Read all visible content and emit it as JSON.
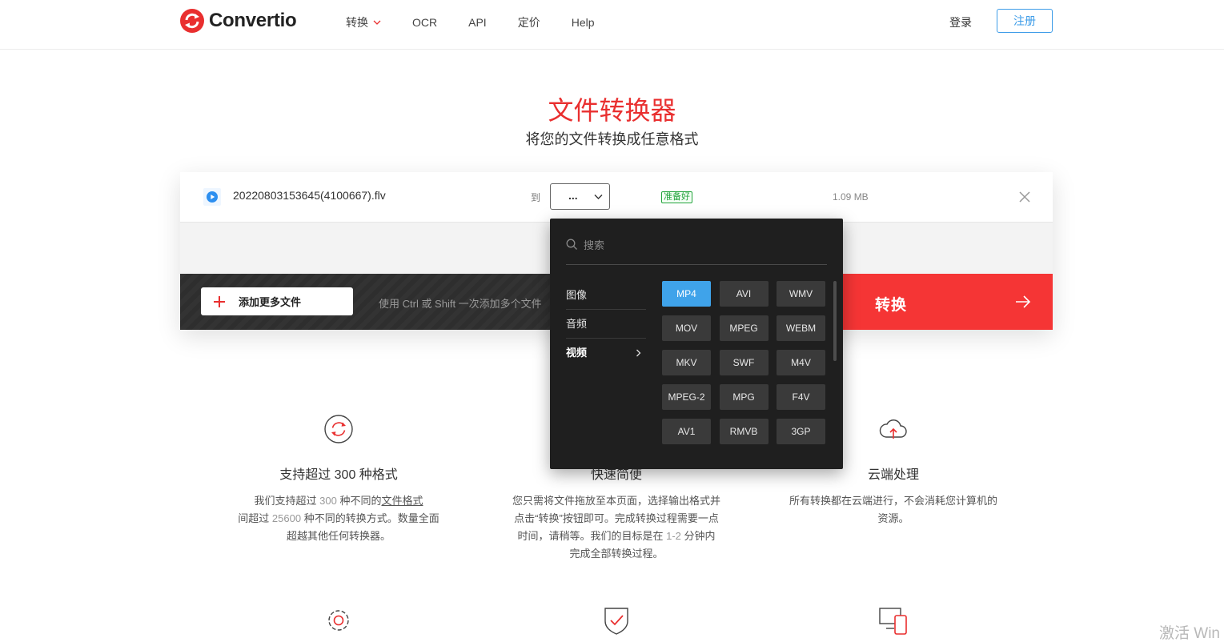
{
  "header": {
    "logo_text": "Convertio",
    "nav": [
      {
        "label": "转换",
        "has_dropdown": true
      },
      {
        "label": "OCR"
      },
      {
        "label": "API"
      },
      {
        "label": "定价"
      },
      {
        "label": "Help"
      }
    ],
    "login_label": "登录",
    "register_label": "注册"
  },
  "hero": {
    "title": "文件转换器",
    "subtitle": "将您的文件转换成任意格式"
  },
  "converter": {
    "file_name": "20220803153645(4100667).flv",
    "to_label": "到",
    "format_value": "...",
    "status": "准备好",
    "file_size": "1.09 MB",
    "add_files_label": "添加更多文件",
    "hint": "使用 Ctrl 或 Shift 一次添加多个文件",
    "convert_label": "转换"
  },
  "dropdown": {
    "search_placeholder": "搜索",
    "categories": [
      {
        "label": "图像",
        "active": false
      },
      {
        "label": "音频",
        "active": false
      },
      {
        "label": "视频",
        "active": true
      }
    ],
    "formats": [
      "MP4",
      "AVI",
      "WMV",
      "MOV",
      "MPEG",
      "WEBM",
      "MKV",
      "SWF",
      "M4V",
      "MPEG-2",
      "MPG",
      "F4V",
      "AV1",
      "RMVB",
      "3GP"
    ],
    "selected_format": "MP4"
  },
  "features": {
    "formats": {
      "title": "支持超过 300 种格式",
      "desc_1": "我们支持超过 ",
      "desc_num1": "300",
      "desc_2": " 种不同的",
      "desc_link": "文件格式",
      "desc_3": "间超过 ",
      "desc_num2": "25600",
      "desc_4": " 种不同的转换方式。数量全面超越其他任何转换器。"
    },
    "speed": {
      "title": "快速简便",
      "desc_1": "您只需将文件拖放至本页面，选择输出格式并点击“转换”按钮即可。完成转换过程需要一点时间，请稍等。我们的目标是在 ",
      "desc_num": "1-2",
      "desc_2": " 分钟内完成全部转换过程。"
    },
    "cloud": {
      "title": "云端处理",
      "desc": "所有转换都在云端进行，不会消耗您计算机的资源。"
    }
  },
  "watermark": "激活 Win",
  "colors": {
    "brand_red": "#e92f2f",
    "convert_red": "#f53535",
    "accent_blue": "#3d9ce8",
    "selected_blue": "#3fa3ea",
    "ready_green": "#21a33b",
    "dark_panel": "#1f1f1f"
  },
  "icons": {
    "logo": "convertio-logo-icon",
    "file": "play-file-icon",
    "remove": "close-icon",
    "add": "plus-icon",
    "convert": "arrow-right-icon",
    "search": "search-icon",
    "feature_formats": "refresh-circle-icon",
    "feature_cloud": "cloud-upload-icon",
    "feature_settings": "gear-icon",
    "feature_security": "shield-check-icon",
    "feature_devices": "devices-icon"
  }
}
